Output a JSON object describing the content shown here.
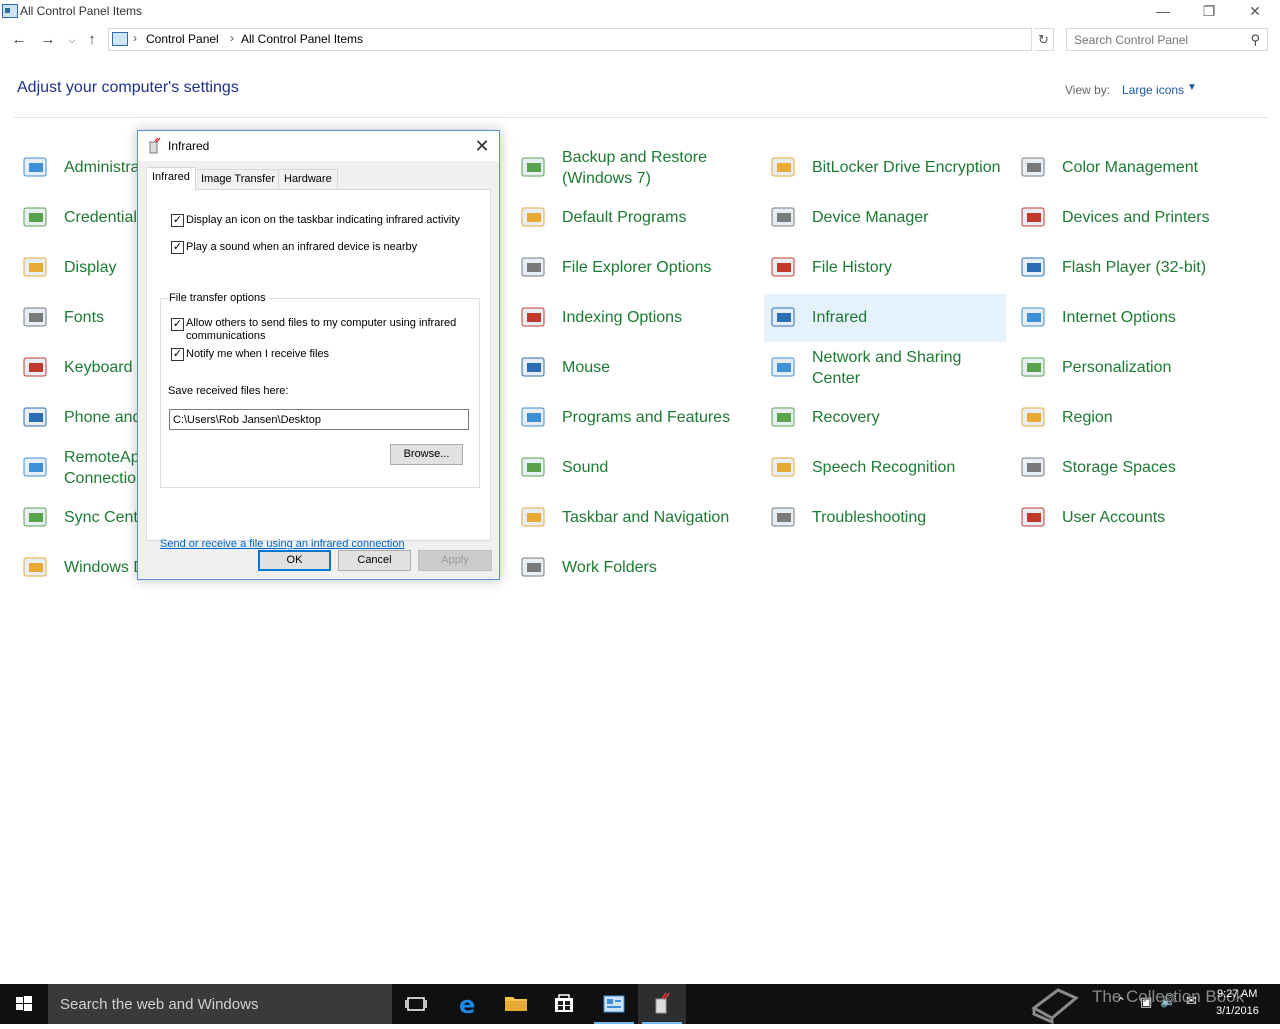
{
  "window": {
    "title": "All Control Panel Items"
  },
  "address": {
    "crumbs": [
      "Control Panel",
      "All Control Panel Items"
    ],
    "search_placeholder": "Search Control Panel"
  },
  "header": {
    "title": "Adjust your computer's settings",
    "view_by_label": "View by:",
    "view_by_value": "Large icons"
  },
  "items": {
    "col1": [
      {
        "label": "Administra",
        "icon": "admin-tools-icon"
      },
      {
        "label": "Credential",
        "icon": "credential-manager-icon"
      },
      {
        "label": "Display",
        "icon": "display-icon"
      },
      {
        "label": "Fonts",
        "icon": "fonts-icon"
      },
      {
        "label": "Keyboard",
        "icon": "keyboard-icon"
      },
      {
        "label": "Phone and",
        "icon": "phone-modem-icon"
      },
      {
        "label": "RemoteApp\nConnection",
        "icon": "remoteapp-icon"
      },
      {
        "label": "Sync Cente",
        "icon": "sync-center-icon"
      },
      {
        "label": "Windows D",
        "icon": "windows-defender-icon"
      }
    ],
    "col3": [
      {
        "label": "Backup and Restore\n(Windows 7)",
        "icon": "backup-restore-icon"
      },
      {
        "label": "Default Programs",
        "icon": "default-programs-icon"
      },
      {
        "label": "File Explorer Options",
        "icon": "folder-options-icon"
      },
      {
        "label": "Indexing Options",
        "icon": "indexing-icon"
      },
      {
        "label": "Mouse",
        "icon": "mouse-icon"
      },
      {
        "label": "Programs and Features",
        "icon": "programs-icon"
      },
      {
        "label": "Sound",
        "icon": "sound-icon"
      },
      {
        "label": "Taskbar and Navigation",
        "icon": "taskbar-icon"
      },
      {
        "label": "Work Folders",
        "icon": "work-folders-icon"
      }
    ],
    "col4": [
      {
        "label": "BitLocker Drive Encryption",
        "icon": "bitlocker-icon"
      },
      {
        "label": "Device Manager",
        "icon": "device-manager-icon"
      },
      {
        "label": "File History",
        "icon": "file-history-icon"
      },
      {
        "label": "Infrared",
        "icon": "infrared-icon"
      },
      {
        "label": "Network and Sharing\nCenter",
        "icon": "network-icon"
      },
      {
        "label": "Recovery",
        "icon": "recovery-icon"
      },
      {
        "label": "Speech Recognition",
        "icon": "microphone-icon"
      },
      {
        "label": "Troubleshooting",
        "icon": "troubleshooting-icon"
      }
    ],
    "col5": [
      {
        "label": "Color Management",
        "icon": "color-management-icon"
      },
      {
        "label": "Devices and Printers",
        "icon": "printer-icon"
      },
      {
        "label": "Flash Player (32-bit)",
        "icon": "flash-icon"
      },
      {
        "label": "Internet Options",
        "icon": "internet-options-icon"
      },
      {
        "label": "Personalization",
        "icon": "personalization-icon"
      },
      {
        "label": "Region",
        "icon": "region-icon"
      },
      {
        "label": "Storage Spaces",
        "icon": "storage-spaces-icon"
      },
      {
        "label": "User Accounts",
        "icon": "user-accounts-icon"
      }
    ],
    "selected": "Infrared"
  },
  "dialog": {
    "title": "Infrared",
    "tabs": [
      "Infrared",
      "Image Transfer",
      "Hardware"
    ],
    "active_tab": "Infrared",
    "options": {
      "taskbar_icon": "Display an icon on the taskbar indicating infrared activity",
      "play_sound": "Play a sound when an infrared device is nearby"
    },
    "group_label": "File transfer options",
    "group_options": {
      "allow_send": "Allow others to send files to my computer using infrared communications",
      "notify": "Notify me when I receive files"
    },
    "checked": true,
    "save_label": "Save received files here:",
    "save_path": "C:\\Users\\Rob Jansen\\Desktop",
    "browse": "Browse...",
    "link": "Send or receive a file using an infrared connection",
    "ok": "OK",
    "cancel": "Cancel",
    "apply": "Apply"
  },
  "taskbar": {
    "search_placeholder": "Search the web and Windows",
    "time": "9:27 AM",
    "date": "3/1/2016",
    "watermark": "The Collection Book"
  },
  "colors": {
    "link_green": "#1c7a32",
    "title_blue": "#1e3287",
    "selection": "#e5f1fb",
    "taskbar": "#101010"
  }
}
